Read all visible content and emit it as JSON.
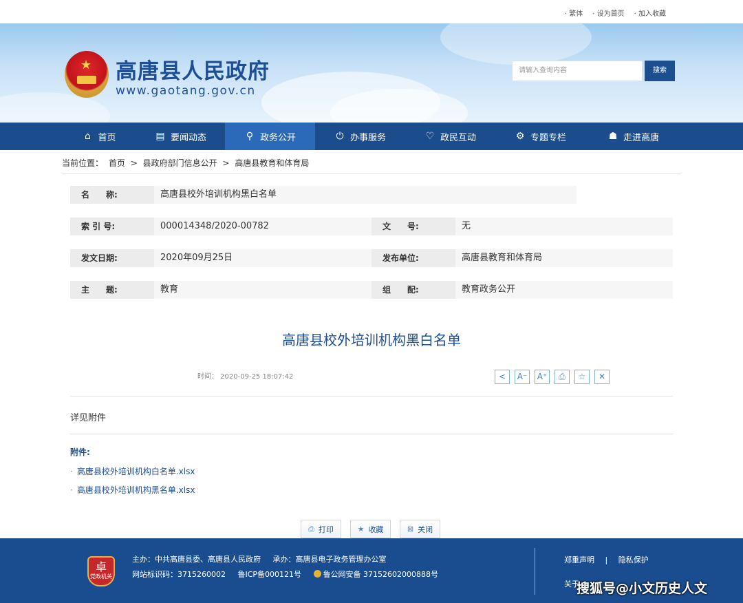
{
  "topbar": {
    "links": [
      "繁体",
      "设为首页",
      "加入收藏"
    ]
  },
  "header": {
    "site_title": "高唐县人民政府",
    "site_url": "www.gaotang.gov.cn",
    "search_placeholder": "请输入查询内容",
    "search_button": "搜索"
  },
  "nav": {
    "items": [
      {
        "label": "首页",
        "icon": "home-icon"
      },
      {
        "label": "要闻动态",
        "icon": "document-icon"
      },
      {
        "label": "政务公开",
        "icon": "search-icon"
      },
      {
        "label": "办事服务",
        "icon": "power-icon"
      },
      {
        "label": "政民互动",
        "icon": "heart-icon"
      },
      {
        "label": "专题专栏",
        "icon": "gear-icon"
      },
      {
        "label": "走进高唐",
        "icon": "group-icon"
      }
    ],
    "active_index": 2
  },
  "breadcrumb": {
    "prefix": "当前位置：",
    "items": [
      "首页",
      "县政府部门信息公开",
      "高唐县教育和体育局"
    ],
    "separator": ">"
  },
  "info": {
    "name_label": "名　　称:",
    "name_value": "高唐县校外培训机构黑白名单",
    "index_label": "索 引 号:",
    "index_value": "000014348/2020-00782",
    "docno_label": "文　　号:",
    "docno_value": "无",
    "date_label": "发文日期:",
    "date_value": "2020年09月25日",
    "publisher_label": "发布单位:",
    "publisher_value": "高唐县教育和体育局",
    "topic_label": "主　　题:",
    "topic_value": "教育",
    "category_label": "组　　配:",
    "category_value": "教育政务公开"
  },
  "article": {
    "title": "高唐县校外培训机构黑白名单",
    "time": "时间：  2020-09-25 18:07:42",
    "body": "详见附件",
    "attachments_title": "附件:",
    "attachments": [
      "高唐县校外培训机构白名单.xlsx",
      "高唐县校外培训机构黑名单.xlsx"
    ]
  },
  "actions": {
    "print": "打印",
    "favorite": "收藏",
    "close": "关闭"
  },
  "footer": {
    "sponsor": "主办：中共高唐县委、高唐县人民政府",
    "organizer": "承办：高唐县电子政务管理办公室",
    "site_id": "网站标识码：3715260002",
    "icp": "鲁ICP备000121号",
    "police": "鲁公网安备 37152602000888号",
    "badge_text": "党政机关",
    "link_statement": "郑重声明",
    "link_privacy": "隐私保护",
    "link_sep": "|",
    "link_about": "关于"
  },
  "watermark": "搜狐号@小文历史人文",
  "colors": {
    "primary": "#1b4c8c",
    "nav_active": "#2b6ab9",
    "title_blue": "#1e4f95",
    "footer_bg": "#1a4d8f"
  }
}
